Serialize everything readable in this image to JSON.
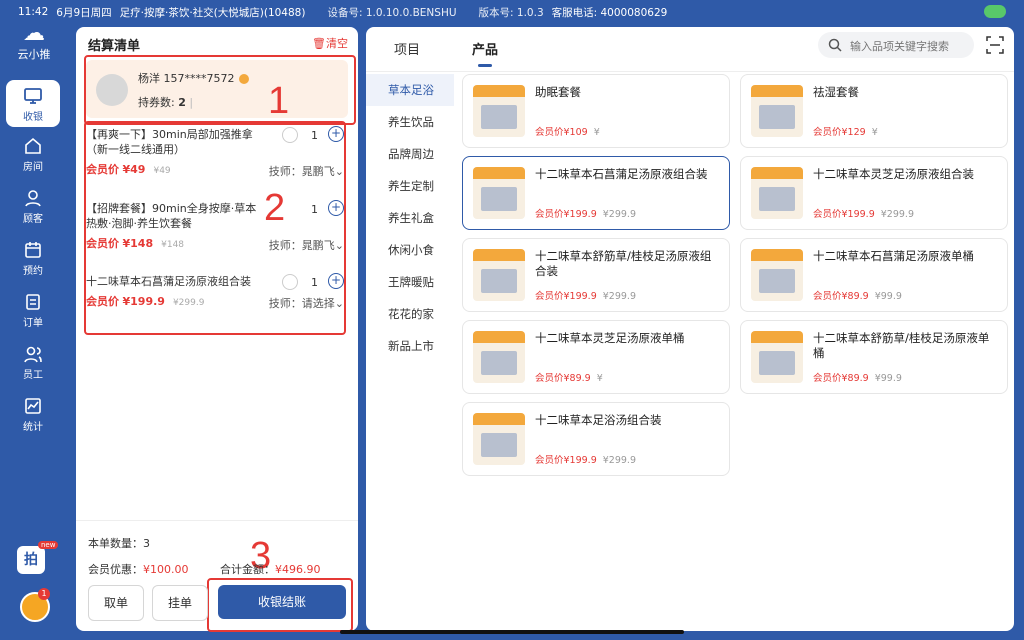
{
  "status": {
    "time": "11:42",
    "date": "6月9日周四",
    "store": "足疗·按摩·茶饮·社交(大悦城店)(10488)",
    "device": "设备号: 1.0.10.0.BENSHU",
    "version": "版本号: 1.0.3",
    "hotline": "客服电话: 4000080629"
  },
  "brand": {
    "name": "云小推"
  },
  "nav": [
    {
      "label": "收银",
      "icon": "monitor-icon"
    },
    {
      "label": "房间",
      "icon": "home-icon"
    },
    {
      "label": "顾客",
      "icon": "user-icon"
    },
    {
      "label": "预约",
      "icon": "calendar-icon"
    },
    {
      "label": "订单",
      "icon": "order-icon"
    },
    {
      "label": "员工",
      "icon": "staff-icon"
    },
    {
      "label": "统计",
      "icon": "chart-icon"
    }
  ],
  "rail_badges": {
    "new": "new",
    "msg": "1",
    "ad": "拍"
  },
  "cart": {
    "title": "结算清单",
    "clear": "清空",
    "member": {
      "name": "杨洋 157****7572",
      "coupon_label": "持券数:",
      "coupon_count": "2"
    },
    "items": [
      {
        "title": "【再爽一下】30min局部加强推拿（新一线二线通用）",
        "qty": "1",
        "vip_label": "会员价",
        "vip_price": "¥49",
        "old_price": "¥49",
        "tech": "技师：晁鹏飞"
      },
      {
        "title": "【招牌套餐】90min全身按摩·草本热敷·泡脚·养生饮套餐",
        "qty": "1",
        "vip_label": "会员价",
        "vip_price": "¥148",
        "old_price": "¥148",
        "tech": "技师：晁鹏飞"
      },
      {
        "title": "十二味草本石菖蒲足汤原液组合装",
        "qty": "1",
        "vip_label": "会员价",
        "vip_price": "¥199.9",
        "old_price": "¥299.9",
        "tech": "技师：请选择"
      }
    ],
    "count_label": "本单数量：",
    "count": "3",
    "discount_label": "会员优惠：",
    "discount": "¥100.00",
    "total_label": "合计金额：",
    "total": "¥496.90",
    "btn_take": "取单",
    "btn_hold": "挂单",
    "btn_pay": "收银结账"
  },
  "annotations": {
    "n1": "1",
    "n2": "2",
    "n3": "3"
  },
  "tabs": [
    {
      "label": "项目"
    },
    {
      "label": "产品"
    }
  ],
  "search": {
    "placeholder": "输入品项关键字搜索"
  },
  "categories": [
    "草本足浴",
    "养生饮品",
    "品牌周边",
    "养生定制",
    "养生礼盒",
    "休闲小食",
    "王牌暖贴",
    "花花的家",
    "新品上市"
  ],
  "products": [
    {
      "title": "助眠套餐",
      "vip": "会员价¥109",
      "old": "¥"
    },
    {
      "title": "祛湿套餐",
      "vip": "会员价¥129",
      "old": "¥"
    },
    {
      "title": "十二味草本石菖蒲足汤原液组合装",
      "vip": "会员价¥199.9",
      "old": "¥299.9"
    },
    {
      "title": "十二味草本灵芝足汤原液组合装",
      "vip": "会员价¥199.9",
      "old": "¥299.9"
    },
    {
      "title": "十二味草本舒筋草/桂枝足汤原液组合装",
      "vip": "会员价¥199.9",
      "old": "¥299.9"
    },
    {
      "title": "十二味草本石菖蒲足汤原液单桶",
      "vip": "会员价¥89.9",
      "old": "¥99.9"
    },
    {
      "title": "十二味草本灵芝足汤原液单桶",
      "vip": "会员价¥89.9",
      "old": "¥"
    },
    {
      "title": "十二味草本舒筋草/桂枝足汤原液单桶",
      "vip": "会员价¥89.9",
      "old": "¥99.9"
    },
    {
      "title": "十二味草本足浴汤组合装",
      "vip": "会员价¥199.9",
      "old": "¥299.9"
    }
  ]
}
